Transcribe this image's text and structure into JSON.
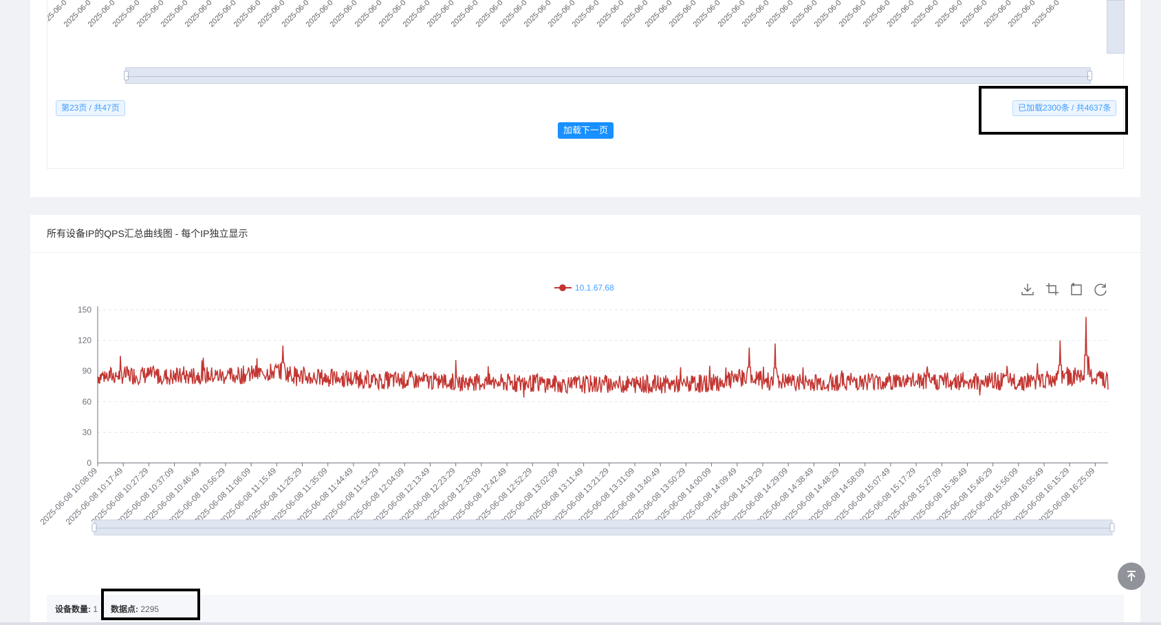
{
  "top_card": {
    "previous_ticks": [
      "2025-06-0",
      "2025-06-0",
      "2025-06-0",
      "2025-06-0",
      "2025-06-0",
      "2025-06-0",
      "2025-06-0",
      "2025-06-0",
      "2025-06-0",
      "2025-06-0",
      "2025-06-0",
      "2025-06-0",
      "2025-06-0",
      "2025-06-0",
      "2025-06-0",
      "2025-06-0",
      "2025-06-0",
      "2025-06-0",
      "2025-06-0",
      "2025-06-0",
      "2025-06-0",
      "2025-06-0",
      "2025-06-0",
      "2025-06-0",
      "2025-06-0",
      "2025-06-0",
      "2025-06-0",
      "2025-06-0",
      "2025-06-0",
      "2025-06-0",
      "2025-06-0",
      "2025-06-0",
      "2025-06-0",
      "2025-06-0",
      "2025-06-0",
      "2025-06-0",
      "2025-06-0",
      "2025-06-0",
      "2025-06-0",
      "2025-06-0",
      "2025-06-0",
      "2025-06-0"
    ],
    "page_tag": "第23页 / 共47页",
    "loaded_tag": "已加载2300条 / 共4637条",
    "load_next_button": "加载下一页"
  },
  "main_card": {
    "title": "所有设备IP的QPS汇总曲线图 - 每个IP独立显示",
    "toolbox_icons": [
      "download-icon",
      "zoom-icon",
      "zoom-reset-icon",
      "restore-icon"
    ]
  },
  "stats": {
    "device_count_label": "设备数量:",
    "device_count_value": "1",
    "data_points_label": "数据点:",
    "data_points_value": "2295"
  },
  "colors": {
    "series": "#c23531",
    "accent": "#409eff",
    "primary_button": "#1890ff"
  },
  "chart_data": {
    "type": "line",
    "legend": "10.1.67.68",
    "legend_position": "top-center",
    "series": [
      {
        "name": "10.1.67.68",
        "color": "#c23531",
        "points": [
          [
            "10:08:09",
            85
          ],
          [
            "10:17:49",
            86
          ],
          [
            "10:27:29",
            86
          ],
          [
            "10:37:09",
            84
          ],
          [
            "10:46:49",
            86
          ],
          [
            "10:56:29",
            85
          ],
          [
            "11:06:09",
            87
          ],
          [
            "11:15:49",
            90
          ],
          [
            "11:25:29",
            84
          ],
          [
            "11:35:09",
            83
          ],
          [
            "11:44:49",
            82
          ],
          [
            "11:54:29",
            81
          ],
          [
            "12:04:09",
            81
          ],
          [
            "12:13:49",
            80
          ],
          [
            "12:23:29",
            79
          ],
          [
            "12:33:09",
            79
          ],
          [
            "12:42:49",
            78
          ],
          [
            "12:52:29",
            78
          ],
          [
            "13:02:09",
            77
          ],
          [
            "13:11:49",
            77
          ],
          [
            "13:21:29",
            77
          ],
          [
            "13:31:09",
            77
          ],
          [
            "13:40:49",
            77
          ],
          [
            "13:50:29",
            77
          ],
          [
            "14:00:09",
            79
          ],
          [
            "14:09:49",
            84
          ],
          [
            "14:19:29",
            80
          ],
          [
            "14:29:09",
            79
          ],
          [
            "14:38:49",
            79
          ],
          [
            "14:48:29",
            80
          ],
          [
            "14:58:09",
            80
          ],
          [
            "15:07:49",
            80
          ],
          [
            "15:17:29",
            80
          ],
          [
            "15:27:09",
            80
          ],
          [
            "15:36:49",
            80
          ],
          [
            "15:46:29",
            80
          ],
          [
            "15:56:09",
            80
          ],
          [
            "16:05:49",
            82
          ],
          [
            "16:15:29",
            86
          ],
          [
            "16:25:09",
            80
          ]
        ],
        "peaks": [
          [
            "11:15:49",
            115
          ],
          [
            "14:09:49",
            113
          ],
          [
            "14:19:29",
            117
          ],
          [
            "16:05:49",
            120
          ],
          [
            "16:15:29",
            143
          ]
        ]
      }
    ],
    "x_tick_labels": [
      "2025-06-08 10:08:09",
      "2025-06-08 10:17:49",
      "2025-06-08 10:27:29",
      "2025-06-08 10:37:09",
      "2025-06-08 10:46:49",
      "2025-06-08 10:56:29",
      "2025-06-08 11:06:09",
      "2025-06-08 11:15:49",
      "2025-06-08 11:25:29",
      "2025-06-08 11:35:09",
      "2025-06-08 11:44:49",
      "2025-06-08 11:54:29",
      "2025-06-08 12:04:09",
      "2025-06-08 12:13:49",
      "2025-06-08 12:23:29",
      "2025-06-08 12:33:09",
      "2025-06-08 12:42:49",
      "2025-06-08 12:52:29",
      "2025-06-08 13:02:09",
      "2025-06-08 13:11:49",
      "2025-06-08 13:21:29",
      "2025-06-08 13:31:09",
      "2025-06-08 13:40:49",
      "2025-06-08 13:50:29",
      "2025-06-08 14:00:09",
      "2025-06-08 14:09:49",
      "2025-06-08 14:19:29",
      "2025-06-08 14:29:09",
      "2025-06-08 14:38:49",
      "2025-06-08 14:48:29",
      "2025-06-08 14:58:09",
      "2025-06-08 15:07:49",
      "2025-06-08 15:17:29",
      "2025-06-08 15:27:09",
      "2025-06-08 15:36:49",
      "2025-06-08 15:46:29",
      "2025-06-08 15:56:09",
      "2025-06-08 16:05:49",
      "2025-06-08 16:15:29",
      "2025-06-08 16:25:09"
    ],
    "y_ticks": [
      0,
      30,
      60,
      90,
      120,
      150
    ],
    "ylim": [
      0,
      150
    ],
    "grid": "horizontal dashed",
    "data_zoom": "slider, full range"
  }
}
